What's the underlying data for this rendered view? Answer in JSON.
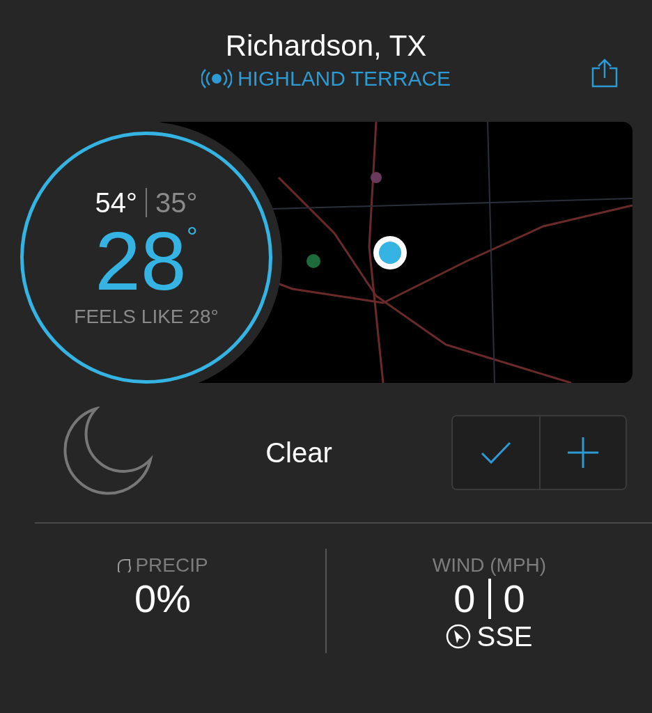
{
  "header": {
    "title": "Richardson, TX",
    "location": "HIGHLAND TERRACE"
  },
  "current": {
    "high": "54°",
    "low": "35°",
    "temp": "28",
    "unit": "°",
    "feels_like": "FEELS LIKE 28°"
  },
  "condition": {
    "text": "Clear",
    "buttons": [
      {
        "kind": "check"
      },
      {
        "kind": "plus"
      }
    ]
  },
  "precip": {
    "label": "PRECIP",
    "value": "0%"
  },
  "wind": {
    "label": "WIND (MPH)",
    "speed": "0",
    "gust": "0",
    "direction": "SSE"
  }
}
